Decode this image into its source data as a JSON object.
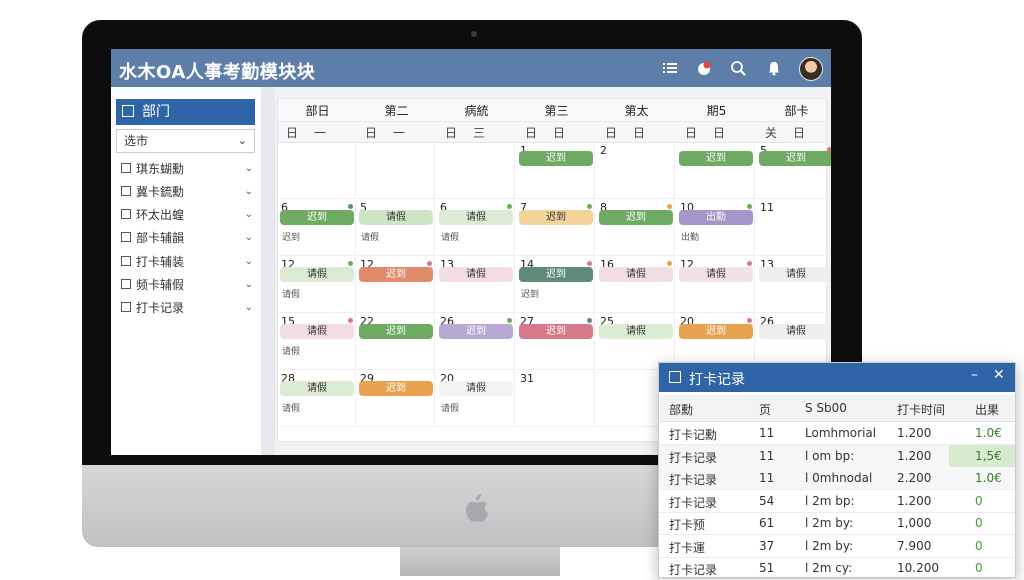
{
  "app": {
    "title": "水木OA人事考勤模块块",
    "header_icons": [
      "list-icon",
      "notification-badge-icon",
      "search-icon",
      "bell-icon",
      "user-avatar"
    ]
  },
  "sidebar": {
    "head_label": "部门",
    "select_value": "选市",
    "items": [
      {
        "label": "琪东蝴勳"
      },
      {
        "label": "冀卡鋶勳"
      },
      {
        "label": "环太出蝗"
      },
      {
        "label": "部卡辅韻"
      },
      {
        "label": "打卡辅装"
      },
      {
        "label": "频卡辅假"
      },
      {
        "label": "打卡记录"
      }
    ]
  },
  "calendar": {
    "weekdays": [
      "部日",
      "第二",
      "病統",
      "第三",
      "第太",
      "期5",
      "部卡"
    ],
    "subheaders": [
      [
        "日",
        "一"
      ],
      [
        "日",
        "一"
      ],
      [
        "日",
        "三"
      ],
      [
        "日",
        "日"
      ],
      [
        "日",
        "日"
      ],
      [
        "日",
        "日"
      ],
      [
        "关",
        "日"
      ]
    ],
    "days": {
      "r0": [
        "",
        "",
        "",
        "1",
        "2",
        "",
        "5"
      ],
      "r1": [
        "6",
        "5",
        "6",
        "7",
        "8",
        "10",
        "11"
      ],
      "r2": [
        "12",
        "12",
        "13",
        "14",
        "16",
        "12",
        "13"
      ],
      "r3": [
        "15",
        "22",
        "26",
        "27",
        "25",
        "20",
        "26"
      ],
      "r4": [
        "28",
        "29",
        "20",
        "31",
        "",
        "",
        ""
      ]
    },
    "events": {
      "e_r0c3": "迟到",
      "e_r0c5": "迟到",
      "e_r0c6": "迟到",
      "e_r1c0": "迟到",
      "e_r1c1": "请假",
      "e_r1c2": "请假",
      "e_r1c3": "迟到",
      "e_r1c4": "迟到",
      "e_r1c5": "出勤",
      "e_r2c0": "请假",
      "e_r2c1": "迟到",
      "e_r2c2": "请假",
      "e_r2c3": "迟到",
      "e_r2c4": "请假",
      "e_r2c5": "请假",
      "e_r2c6": "请假",
      "e_r3c0": "请假",
      "e_r3c1": "迟到",
      "e_r3c2": "迟到",
      "e_r3c3": "迟到",
      "e_r3c4": "请假",
      "e_r3c5": "迟到",
      "e_r3c6": "请假",
      "e_r4c0": "请假",
      "e_r4c1": "迟到",
      "e_r4c2": "请假"
    },
    "sub_notes": {
      "s_r1c0": "迟到",
      "s_r1c1": "请假",
      "s_r1c2": "请假",
      "s_r1c5": "出勤",
      "s_r2c0": "请假",
      "s_r2c3": "迟到",
      "s_r3c0": "请假",
      "s_r4c0": "请假",
      "s_r4c2": "请假"
    }
  },
  "popup": {
    "title": "打卡记录",
    "minimize": "–",
    "close": "✕",
    "columns": [
      "部勳",
      "页",
      "S Sb00",
      "打卡时间",
      "出果"
    ],
    "rows": [
      {
        "name": "打卡记勳",
        "num": "11",
        "type": "Lomhmorial",
        "time": "1.200",
        "result": "1.0€"
      },
      {
        "name": "打卡记录",
        "num": "11",
        "type": "l om bp:",
        "time": "1.200",
        "result": "1,5€"
      },
      {
        "name": "打卡记录",
        "num": "11",
        "type": "l 0mhnodal",
        "time": "2.200",
        "result": "1.0€"
      },
      {
        "name": "打卡记录",
        "num": "54",
        "type": "l 2m bp:",
        "time": "1.200",
        "result": "0"
      },
      {
        "name": "打卡预",
        "num": "61",
        "type": "l 2m by:",
        "time": "1,000",
        "result": "0"
      },
      {
        "name": "打卡運",
        "num": "37",
        "type": "l 2m by:",
        "time": "7.900",
        "result": "0"
      },
      {
        "name": "打卡记录",
        "num": "51",
        "type": "l 2m cy:",
        "time": "10.200",
        "result": "0"
      }
    ]
  },
  "colors": {
    "header": "#5c7ea9",
    "primary": "#2f64a7",
    "event_green": "#6eaa62",
    "event_orange": "#e9a24f",
    "event_pink": "#d8788b",
    "event_purple": "#a695c9",
    "event_teal": "#5e8a77"
  }
}
